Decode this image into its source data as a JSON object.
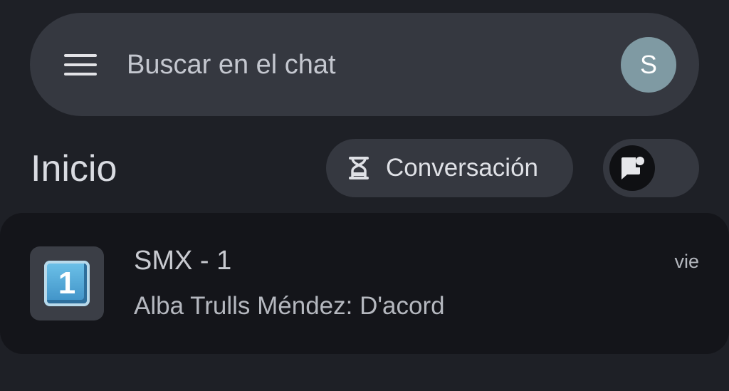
{
  "search": {
    "placeholder": "Buscar en el chat",
    "menu_icon": "menu-icon",
    "avatar_initial": "S",
    "avatar_color": "#7f9aa3"
  },
  "header": {
    "title": "Inicio",
    "conversation_chip": {
      "icon": "hourglass-icon",
      "label": "Conversación"
    },
    "new_chat_toggle": {
      "icon": "chat-badge-icon"
    }
  },
  "chats": [
    {
      "avatar_emoji": "1",
      "avatar_icon": "keycap-one-icon",
      "title": "SMX - 1",
      "preview": "Alba Trulls Méndez: D'acord",
      "time": "vie"
    }
  ],
  "colors": {
    "background": "#1e2026",
    "surface": "#353840",
    "list_background": "#14151a",
    "text_primary": "#d9dbe1",
    "text_secondary": "#b5b8bf"
  }
}
